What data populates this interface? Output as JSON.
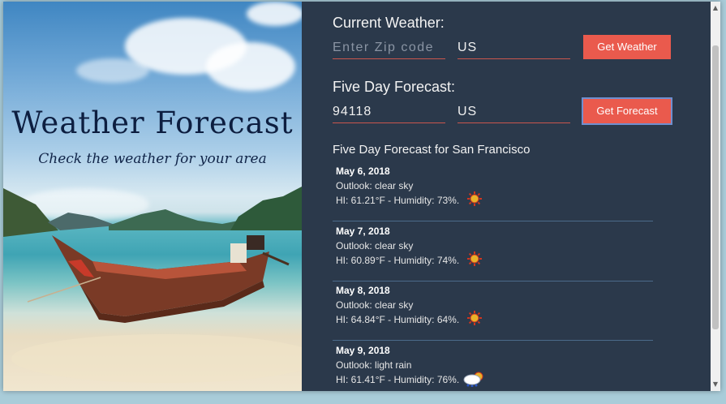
{
  "hero": {
    "title": "Weather Forecast",
    "subtitle": "Check the weather for your area"
  },
  "current": {
    "heading": "Current Weather:",
    "zip_placeholder": "Enter Zip code",
    "country": "US",
    "button": "Get Weather"
  },
  "five_day": {
    "heading": "Five Day Forecast:",
    "zip": "94118",
    "country": "US",
    "button": "Get Forecast"
  },
  "forecast": {
    "title": "Five Day Forecast for San Francisco",
    "days": [
      {
        "date": "May 6, 2018",
        "outlook": "Outlook: clear sky",
        "stats": "HI: 61.21°F - Humidity: 73%.",
        "icon": "sun-icon"
      },
      {
        "date": "May 7, 2018",
        "outlook": "Outlook: clear sky",
        "stats": "HI: 60.89°F - Humidity: 74%.",
        "icon": "sun-icon"
      },
      {
        "date": "May 8, 2018",
        "outlook": "Outlook: clear sky",
        "stats": "HI: 64.84°F - Humidity: 64%.",
        "icon": "sun-icon"
      },
      {
        "date": "May 9, 2018",
        "outlook": "Outlook: light rain",
        "stats": "HI: 61.41°F - Humidity: 76%.",
        "icon": "rain-cloud-icon"
      }
    ]
  },
  "colors": {
    "panel_bg": "#2b394b",
    "button_bg": "#ea5a4d",
    "divider": "#4b6a8a",
    "title_text": "#0d1e40"
  }
}
